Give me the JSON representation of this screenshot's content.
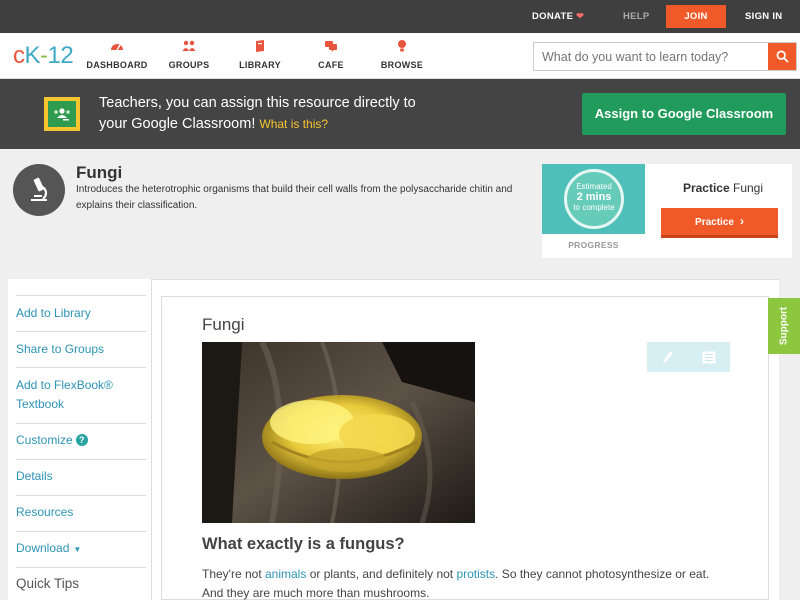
{
  "topbar": {
    "donate": "DONATE",
    "help": "HELP",
    "join": "JOIN",
    "signin": "SIGN IN"
  },
  "logo": {
    "c": "c",
    "k": "K",
    "dash": "-",
    "num": "12"
  },
  "nav": [
    {
      "label": "DASHBOARD",
      "icon": "dashboard-icon"
    },
    {
      "label": "GROUPS",
      "icon": "groups-icon"
    },
    {
      "label": "LIBRARY",
      "icon": "library-icon"
    },
    {
      "label": "CAFE",
      "icon": "cafe-icon"
    },
    {
      "label": "BROWSE",
      "icon": "browse-icon"
    }
  ],
  "search": {
    "placeholder": "What do you want to learn today?"
  },
  "banner": {
    "line1": "Teachers, you can assign this resource directly to",
    "line2": "your Google Classroom!",
    "what": "What is this?",
    "assign": "Assign to Google Classroom"
  },
  "header": {
    "title": "Fungi",
    "description": "Introduces the heterotrophic organisms that build their cell walls from the polysaccharide chitin and explains their classification."
  },
  "practice": {
    "estimated": "Estimated",
    "mins": "2 mins",
    "to_complete": "to complete",
    "progress": "PROGRESS",
    "title_bold": "Practice",
    "title_rest": "Fungi",
    "button": "Practice"
  },
  "sidebar": {
    "items": [
      "Add to Library",
      "Share to Groups",
      "Add to FlexBook®",
      "Textbook",
      "Customize",
      "Details",
      "Resources",
      "Download"
    ],
    "help_mark": "?",
    "caret": "▼",
    "quick_tips": "Quick Tips"
  },
  "content": {
    "title": "Fungi",
    "heading": "What exactly is a fungus?",
    "p1": "They're not ",
    "link1": "animals",
    "p2": " or plants, and definitely not ",
    "link2": "protists",
    "p3": ". So they cannot photosynthesize or eat.",
    "p4": "And they are much more than mushrooms."
  },
  "support": "Support",
  "colors": {
    "accent": "#f05a28",
    "link": "#2d94b5",
    "classroom": "#209b5c",
    "support": "#8dc63f"
  }
}
